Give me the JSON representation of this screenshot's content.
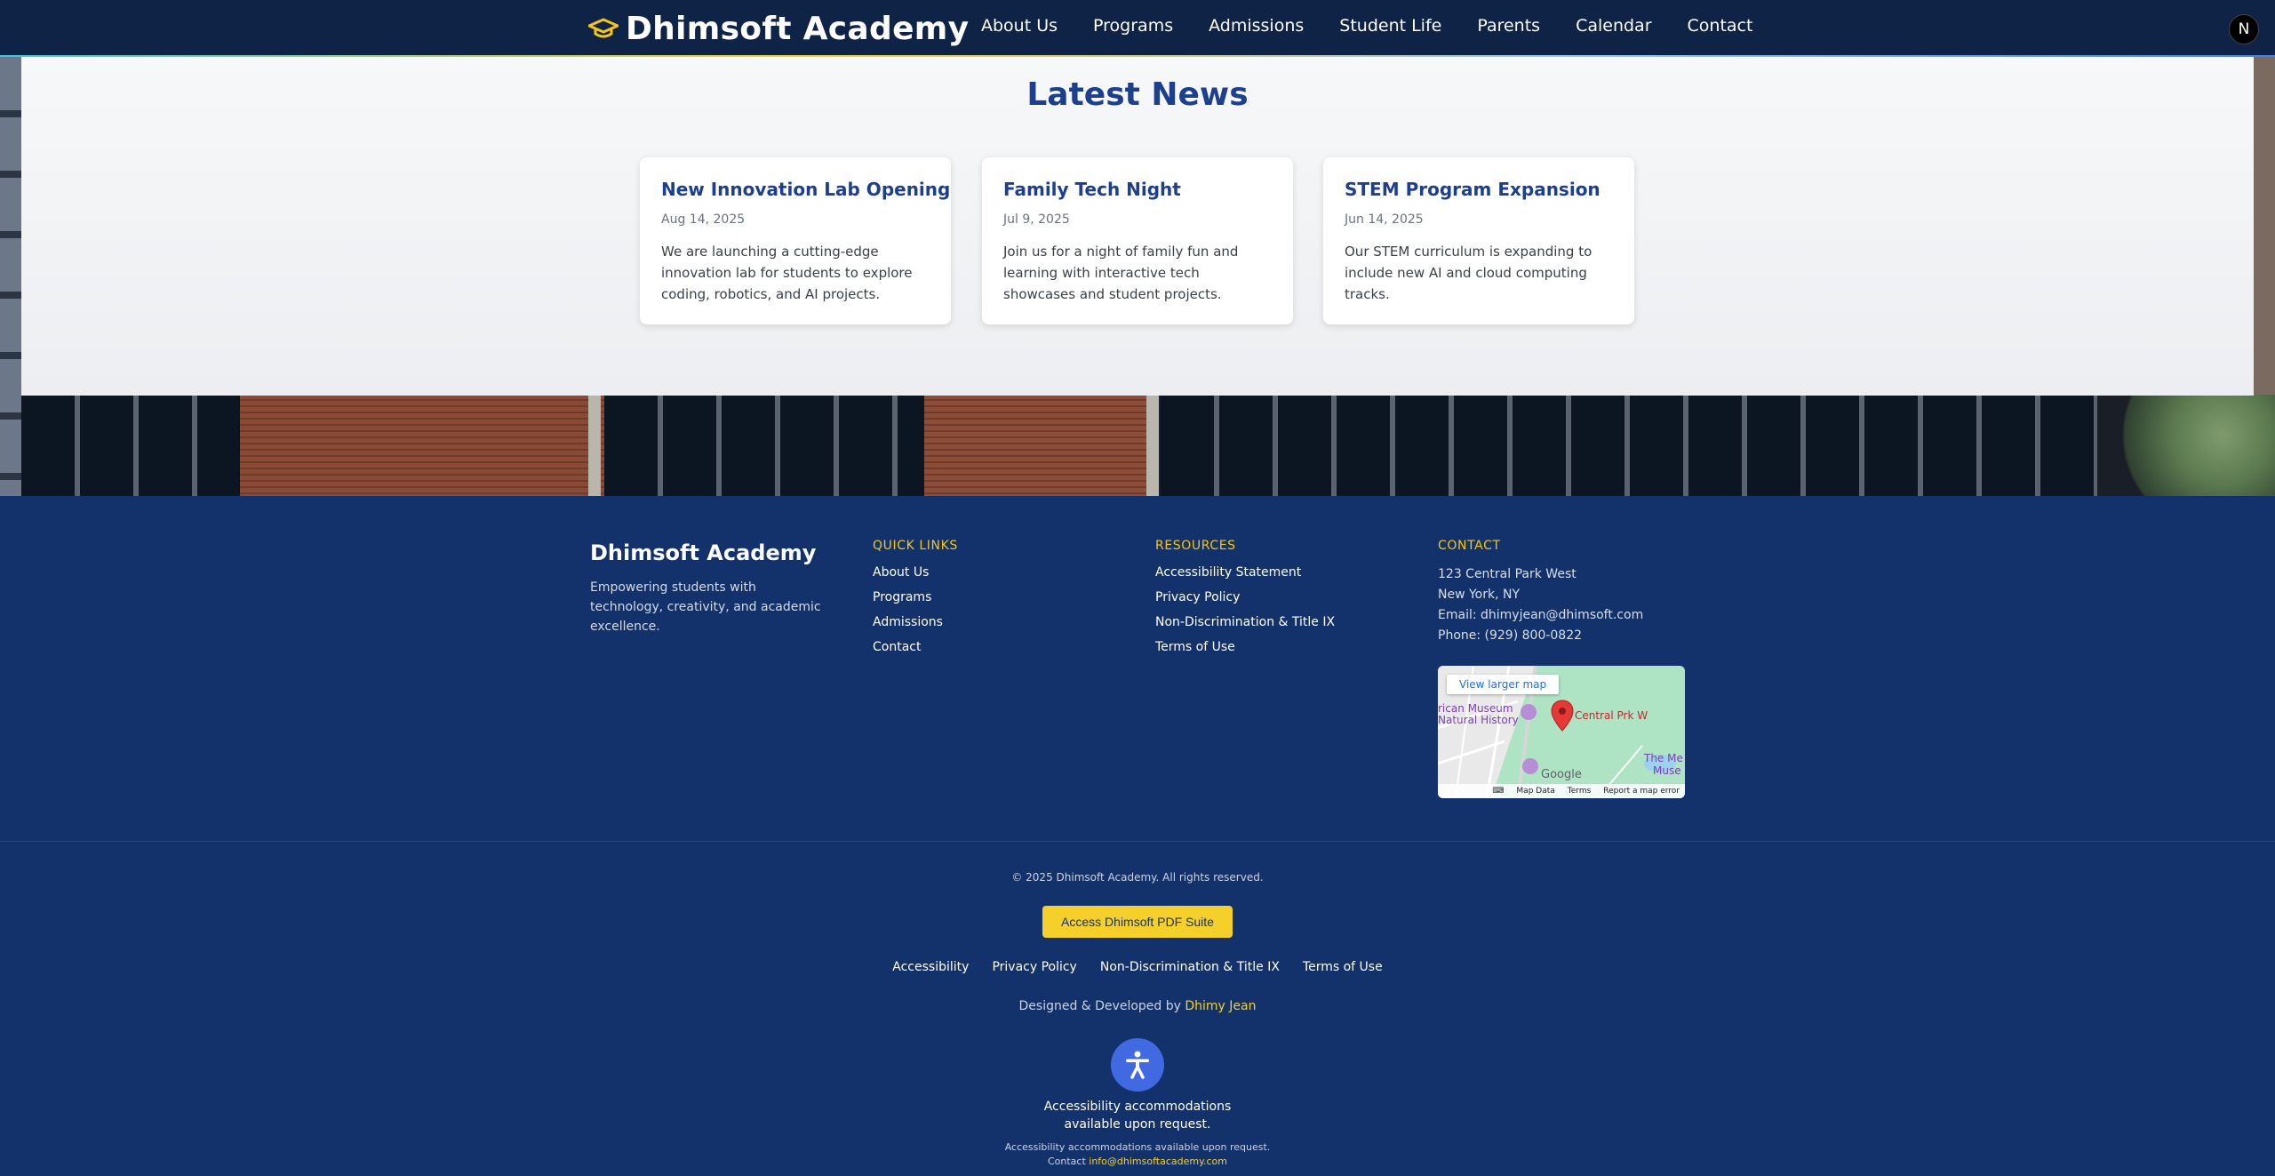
{
  "header": {
    "brand": "Dhimsoft Academy",
    "nav": [
      "About Us",
      "Programs",
      "Admissions",
      "Student Life",
      "Parents",
      "Calendar",
      "Contact"
    ],
    "avatar_letter": "N"
  },
  "news": {
    "title": "Latest News",
    "cards": [
      {
        "title": "New Innovation Lab Opening",
        "date": "Aug 14, 2025",
        "body": "We are launching a cutting-edge innovation lab for students to explore coding, robotics, and AI projects."
      },
      {
        "title": "Family Tech Night",
        "date": "Jul 9, 2025",
        "body": "Join us for a night of family fun and learning with interactive tech showcases and student projects."
      },
      {
        "title": "STEM Program Expansion",
        "date": "Jun 14, 2025",
        "body": "Our STEM curriculum is expanding to include new AI and cloud computing tracks."
      }
    ]
  },
  "footer": {
    "brand": "Dhimsoft Academy",
    "tagline": "Empowering students with technology, creativity, and academic excellence.",
    "quick_links": {
      "heading": "QUICK LINKS",
      "items": [
        "About Us",
        "Programs",
        "Admissions",
        "Contact"
      ]
    },
    "resources": {
      "heading": "RESOURCES",
      "items": [
        "Accessibility Statement",
        "Privacy Policy",
        "Non-Discrimination & Title IX",
        "Terms of Use"
      ]
    },
    "contact": {
      "heading": "CONTACT",
      "address1": "123 Central Park West",
      "address2": "New York, NY",
      "email": "Email: dhimyjean@dhimsoft.com",
      "phone": "Phone: (929) 800-0822"
    },
    "map": {
      "view_larger": "View larger map",
      "pin_label": "Central Prk W",
      "museum_label_1": "rican Museum",
      "museum_label_2": "Natural History",
      "met_label_1": "The Me",
      "met_label_2": "Muse",
      "google": "Google",
      "map_data": "Map Data",
      "terms": "Terms",
      "report": "Report a map error"
    },
    "copyright": "© 2025 Dhimsoft Academy. All rights reserved.",
    "pdf_button": "Access Dhimsoft PDF Suite",
    "bottom_links": [
      "Accessibility",
      "Privacy Policy",
      "Non-Discrimination & Title IX",
      "Terms of Use"
    ],
    "credit_prefix": "Designed & Developed by",
    "credit_author": "Dhimy Jean",
    "a11y_line1": "Accessibility accommodations",
    "a11y_line2": "available upon request.",
    "a11y_small1": "Accessibility accommodations available upon request.",
    "a11y_small2_prefix": "Contact",
    "a11y_small2_email": "info@dhimsoftacademy.com"
  },
  "colors": {
    "header_bg": "#0f2346",
    "footer_bg": "#13326b",
    "accent_yellow": "#f5d02b",
    "title_blue": "#1d3f8f",
    "a11y_blue": "#4169e1"
  }
}
